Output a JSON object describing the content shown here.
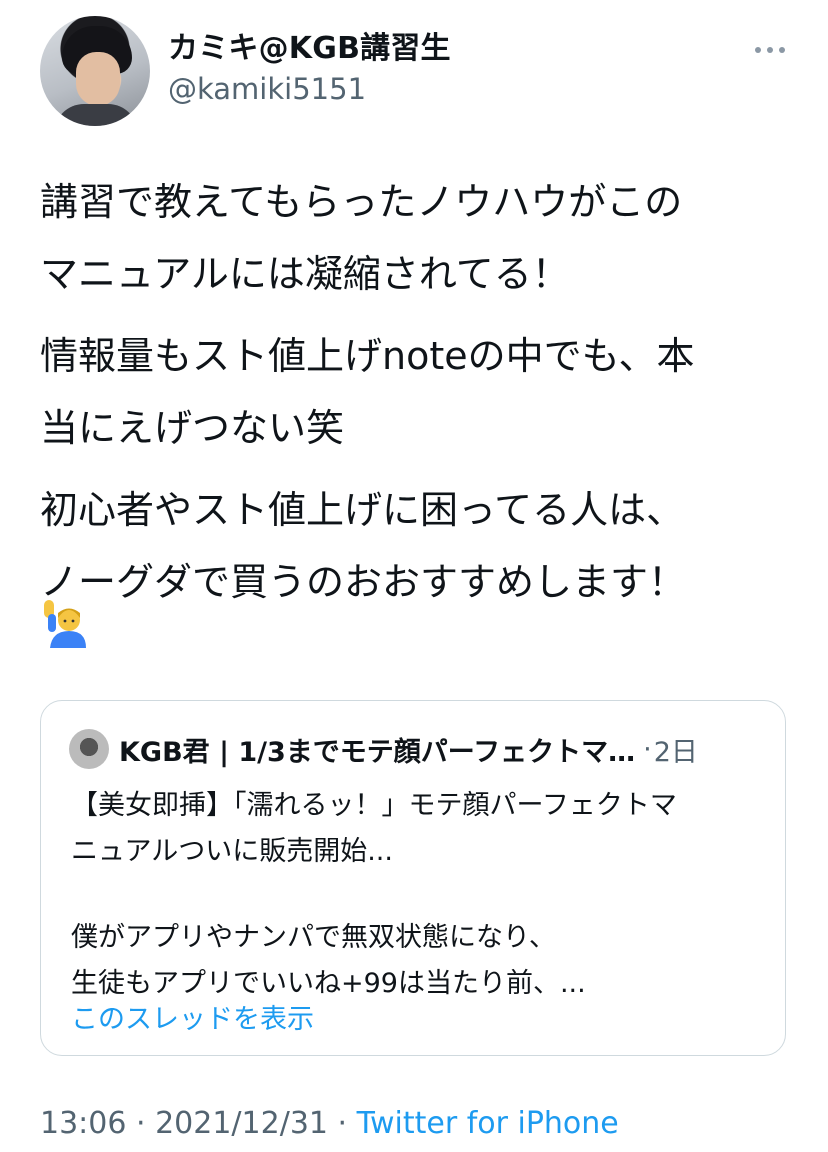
{
  "author": {
    "display_name": "カミキ@KGB講習生",
    "handle": "@kamiki5151"
  },
  "tweet": {
    "paragraphs": [
      "講習で教えてもらったノウハウがこの\nマニュアルには凝縮されてる！",
      "情報量もスト値上げnoteの中でも、本\n当にえげつない笑",
      "初心者やスト値上げに困ってる人は、\nノーグダで買うのおおすすめします！"
    ],
    "emoji": "raising-hand-man-emoji"
  },
  "quote": {
    "display_name": "KGB君 | 1/3までモテ顔パーフェクトマ…",
    "separator": "·",
    "time": "2日",
    "lines": [
      "【美女即挿】「濡れるッ！」モテ顔パーフェクトマ",
      "ニュアルついに販売開始..."
    ],
    "lines2": [
      "僕がアプリやナンパで無双状態になり、",
      "生徒もアプリでいいね+99は当たり前、..."
    ],
    "show_thread": "このスレッドを表示"
  },
  "meta": {
    "time": "13:06",
    "sep1": " · ",
    "date": "2021/12/31",
    "sep2": " · ",
    "source": "Twitter for iPhone"
  },
  "colors": {
    "link": "#1d9bf0",
    "secondary": "#536471",
    "border": "#cfd9de"
  }
}
